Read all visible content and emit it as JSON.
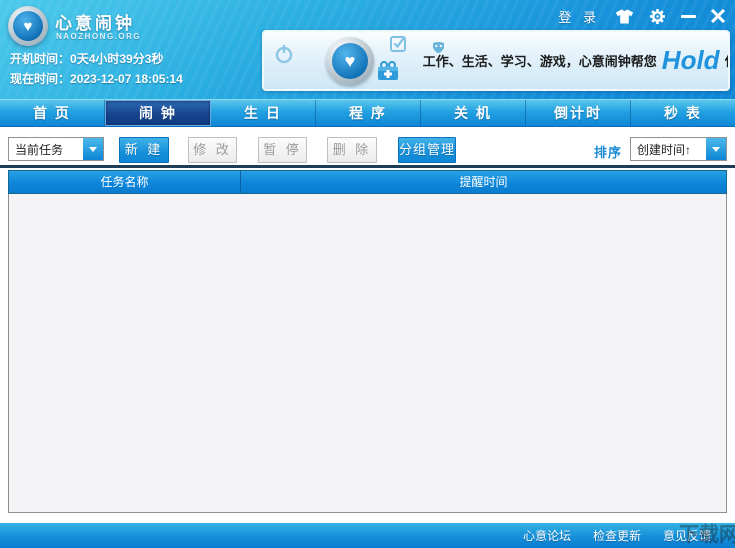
{
  "window": {
    "app_title": "心意闹钟",
    "app_subtitle": "NAOZHONG.ORG",
    "login": "登 录",
    "boot_time_label": "开机时间：",
    "boot_time_value": "0天4小时39分3秒",
    "current_time_label": "现在时间：",
    "current_time_value": "2023-12-07 18:05:14"
  },
  "banner": {
    "text": "工作、生活、学习、游戏，心意闹钟帮您",
    "highlight": "Hold",
    "suffix": "住!"
  },
  "tabs": [
    {
      "label": "首 页",
      "active": false
    },
    {
      "label": "闹 钟",
      "active": true
    },
    {
      "label": "生 日",
      "active": false
    },
    {
      "label": "程 序",
      "active": false
    },
    {
      "label": "关 机",
      "active": false
    },
    {
      "label": "倒计时",
      "active": false
    },
    {
      "label": "秒 表",
      "active": false
    }
  ],
  "toolbar": {
    "filter_value": "当前任务",
    "new_label": "新 建",
    "modify_label": "修 改",
    "pause_label": "暂 停",
    "delete_label": "删 除",
    "group_label": "分组管理",
    "sort_label": "排序",
    "sort_value": "创建时间↑"
  },
  "table": {
    "col_task_name": "任务名称",
    "col_remind_time": "提醒时间",
    "rows": []
  },
  "footer": {
    "forum": "心意论坛",
    "update": "检查更新",
    "feedback": "意见反馈"
  },
  "watermark": "下载网",
  "colors": {
    "accent": "#0f86d6",
    "active_tab": "#16448e",
    "header_top": "#4ecaec",
    "header_bottom": "#0f86d6",
    "footer_top": "#35b2e4",
    "footer_bottom": "#0b7cce"
  }
}
